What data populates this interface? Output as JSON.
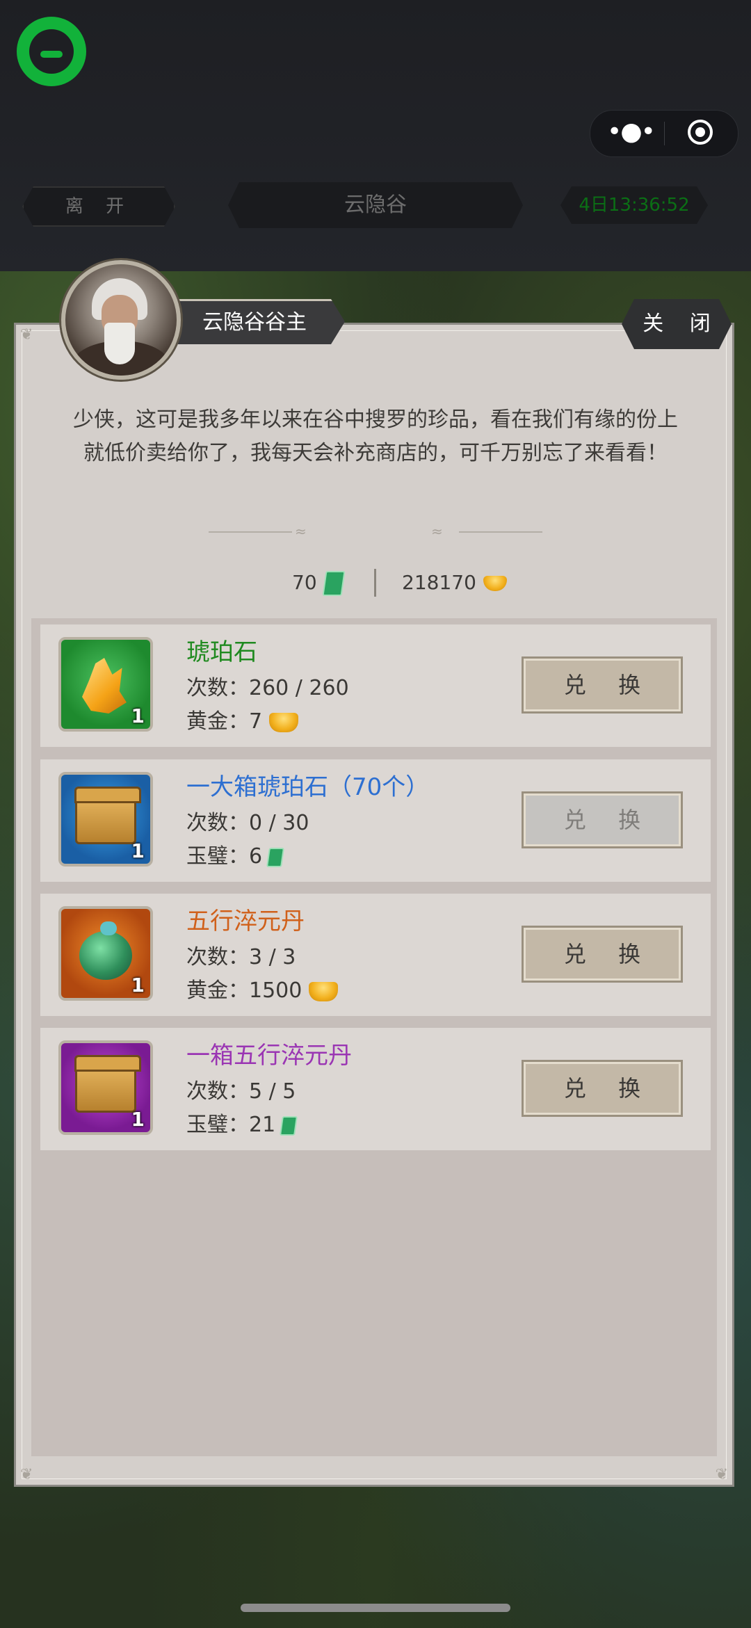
{
  "top_bar": {
    "leave_label": "离 开",
    "location_title": "云隐谷",
    "timer": "4日13:36:52",
    "more_icon": "more-dots-icon",
    "close_miniprogram_icon": "target-circle-icon"
  },
  "npc": {
    "name": "云隐谷谷主",
    "close_label": "关 闭",
    "intro": "少侠，这可是我多年以来在谷中搜罗的珍品，看在我们有缘的份上就低价卖给你了，我每天会补充商店的，可千万别忘了来看看！"
  },
  "balance": {
    "jade": "70",
    "gold": "218170"
  },
  "items": [
    {
      "name": "琥珀石",
      "name_color": "#1f8a1f",
      "count_badge": "1",
      "times_label": "次数：",
      "times_value": "260 / 260",
      "price_label": "黄金：",
      "price_value": "7",
      "currency": "gold",
      "button_label": "兑 换",
      "enabled": true,
      "icon": "amber-crystal-icon"
    },
    {
      "name": "一大箱琥珀石（70个）",
      "name_color": "#2d6fd1",
      "count_badge": "1",
      "times_label": "次数：",
      "times_value": "0 / 30",
      "price_label": "玉璧：",
      "price_value": "6",
      "currency": "jade",
      "button_label": "兑 换",
      "enabled": false,
      "icon": "wooden-chest-icon"
    },
    {
      "name": "五行淬元丹",
      "name_color": "#d0601a",
      "count_badge": "1",
      "times_label": "次数：",
      "times_value": "3 / 3",
      "price_label": "黄金：",
      "price_value": "1500",
      "currency": "gold",
      "button_label": "兑 换",
      "enabled": true,
      "icon": "jade-gourd-icon"
    },
    {
      "name": "一箱五行淬元丹",
      "name_color": "#9a35b3",
      "count_badge": "1",
      "times_label": "次数：",
      "times_value": "5 / 5",
      "price_label": "玉璧：",
      "price_value": "21",
      "currency": "jade",
      "button_label": "兑 换",
      "enabled": true,
      "icon": "wooden-chest-icon"
    }
  ]
}
